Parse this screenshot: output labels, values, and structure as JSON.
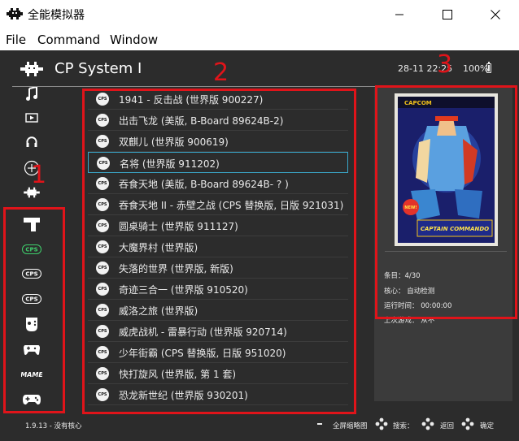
{
  "window": {
    "title": "全能模拟器",
    "controls": {
      "minimize_icon": "minimize-icon",
      "maximize_icon": "maximize-icon",
      "close_icon": "close-icon"
    }
  },
  "menu": [
    "File",
    "Command",
    "Window"
  ],
  "header": {
    "title": "CP System I",
    "clock": "28-11 22:25",
    "battery": "100%"
  },
  "sidebar": {
    "items": [
      {
        "icon": "music-icon"
      },
      {
        "icon": "video-icon"
      },
      {
        "icon": "history-icon"
      },
      {
        "icon": "add-icon"
      },
      {
        "icon": "retroarch-icon"
      },
      {
        "icon": "gun-icon"
      },
      {
        "icon": "cps-icon",
        "text": "CPS"
      },
      {
        "icon": "cps-icon",
        "text": "CPS"
      },
      {
        "icon": "cps-icon",
        "text": "CPS"
      },
      {
        "icon": "gamepad-icon"
      },
      {
        "icon": "gamepad-icon"
      },
      {
        "icon": "mame-icon",
        "text": "MAME"
      },
      {
        "icon": "gamepad-icon"
      }
    ]
  },
  "games": [
    "1941 - 反击战 (世界版 900227)",
    "出击飞龙 (美版, B-Board 89624B-2)",
    "双麒儿 (世界版 900619)",
    "名将 (世界版 911202)",
    "吞食天地 (美版, B-Board 89624B- ? )",
    "吞食天地 II - 赤壁之战 (CPS 替换版, 日版 921031)",
    "圆桌骑士 (世界版 911127)",
    "大魔界村 (世界版)",
    "失落的世界 (世界版, 新版)",
    "奇迹三合一 (世界版 910520)",
    "威洛之旅 (世界版)",
    "威虎战机 - 雷暴行动 (世界版 920714)",
    "少年街霸 (CPS 替换版, 日版 951020)",
    "快打旋风 (世界版, 第 1 套)",
    "恐龙新世纪 (世界版 930201)"
  ],
  "row_icon_text": "CPS",
  "selected_index": 3,
  "info": {
    "box_art_publisher": "CAPCOM",
    "box_art_title": "CAPTAIN COMMANDO",
    "box_art_badge": "NEW!",
    "entry": "条目：4/30",
    "core": "核心： 自动检测",
    "runtime": "运行时间： 00:00:00",
    "last_played": "上次游戏： 从不"
  },
  "footer": {
    "version": "1.9.13 - 没有核心",
    "fullscreen_label": "全屏缩略图",
    "search_label": "搜索：",
    "back_label": "返回",
    "confirm_label": "确定"
  },
  "annotations": [
    "1",
    "2",
    "3"
  ],
  "colors": {
    "background": "#2c2c2c",
    "info_panel": "#3b3b3b",
    "selection": "#3aa6c8",
    "annotation": "#e0141a",
    "cps_green": "#3fd06c"
  }
}
